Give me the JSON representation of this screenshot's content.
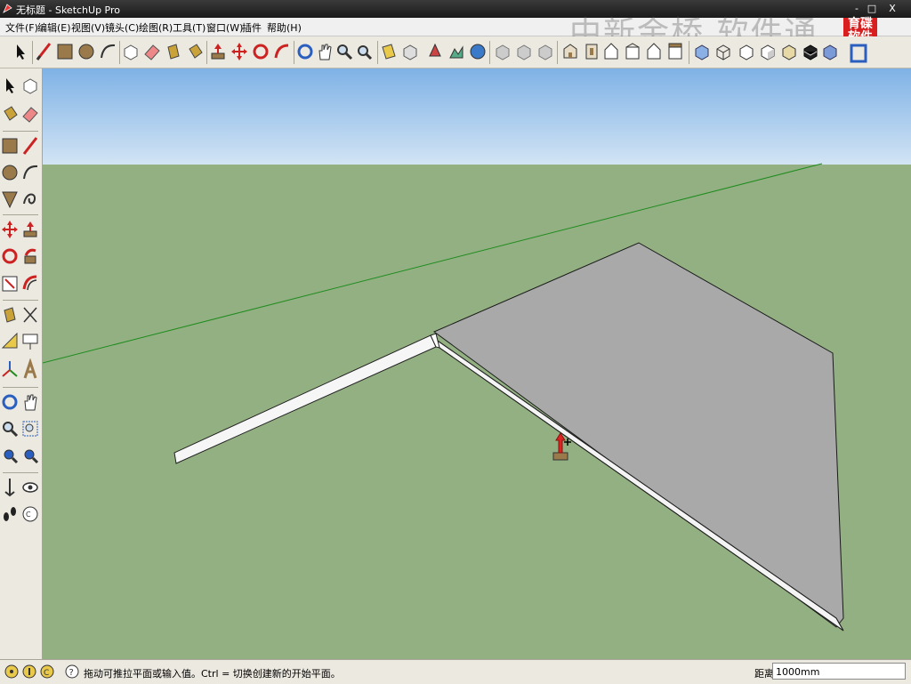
{
  "window": {
    "title": "无标题 - SketchUp Pro",
    "minimize": "-",
    "maximize": "□",
    "close": "X"
  },
  "watermark": "中新金桥 软件通",
  "logo": {
    "line1": "育碟",
    "line2": "软件"
  },
  "menu": [
    {
      "label": "文件(F)"
    },
    {
      "label": "编辑(E)"
    },
    {
      "label": "视图(V)"
    },
    {
      "label": "镜头(C)"
    },
    {
      "label": "绘图(R)"
    },
    {
      "label": "工具(T)"
    },
    {
      "label": "窗口(W)"
    },
    {
      "label": "插件"
    },
    {
      "label": "帮助(H)"
    }
  ],
  "status": {
    "hint": "拖动可推拉平面或输入值。Ctrl = 切换创建新的开始平面。",
    "measure_label": "距离",
    "measure_value": "1000mm"
  },
  "colors": {
    "sky_top": "#7fb2e6",
    "sky_bottom": "#d2e4f4",
    "ground": "#93b082",
    "face_gray": "#a9a9a9",
    "edge": "#1a1a1a",
    "axis_green": "#1f8c1f",
    "accent_red": "#d81e1e"
  }
}
